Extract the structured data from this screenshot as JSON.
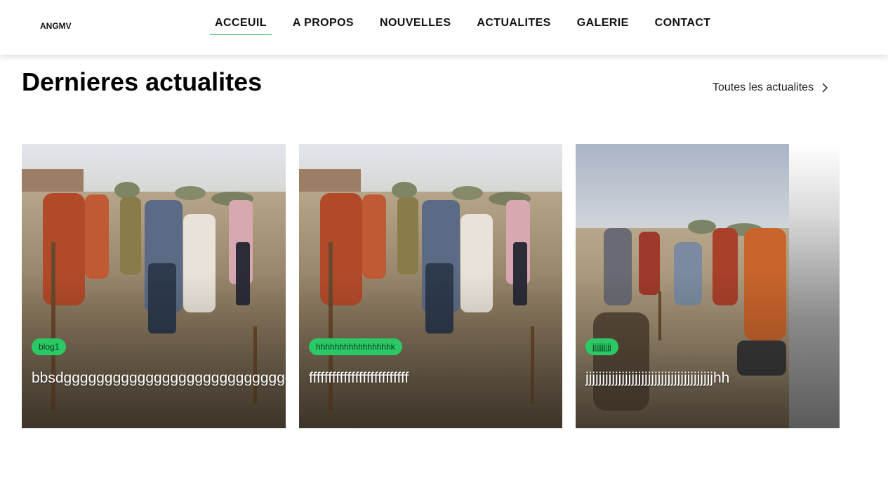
{
  "header": {
    "logo": "ANGMV",
    "nav": [
      {
        "label": "ACCEUIL",
        "active": true
      },
      {
        "label": "A PROPOS",
        "active": false
      },
      {
        "label": "NOUVELLES",
        "active": false
      },
      {
        "label": "ACTUALITES",
        "active": false
      },
      {
        "label": "GALERIE",
        "active": false
      },
      {
        "label": "CONTACT",
        "active": false
      }
    ]
  },
  "news": {
    "title": "Dernieres actualites",
    "see_all_label": "Toutes les actualites",
    "see_all_icon": "chevron-right-icon",
    "cards": [
      {
        "category": "blog1",
        "title": "bbsdgggggggggggggggggggggggggggg",
        "image": "people-digging-field-photo"
      },
      {
        "category": "hhhhhhhhhhhhhhhhk",
        "title": "ffffffffffffffffffffffffff",
        "image": "people-digging-field-photo"
      },
      {
        "category": "jjjjjjjjjj",
        "title": "jjjjjjjjjjjjjjjjjjjjjjjjjjjjjjjjjjjjjjjhh",
        "image": "women-working-field-photo"
      }
    ]
  },
  "colors": {
    "accent_green": "#2bc866",
    "nav_underline": "#27b35b",
    "badge_text": "#0d3a1c"
  }
}
